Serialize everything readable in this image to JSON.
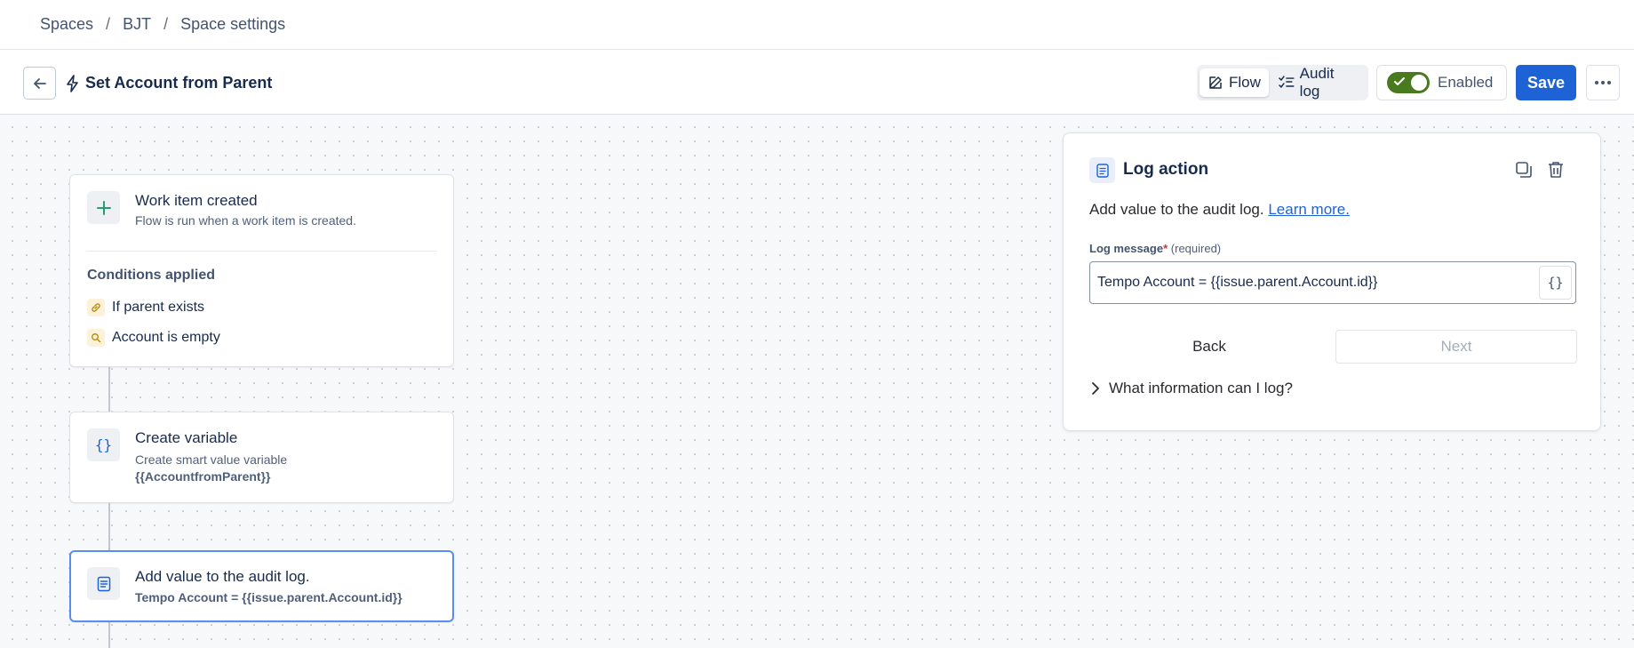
{
  "breadcrumb": {
    "items": [
      "Spaces",
      "BJT",
      "Space settings"
    ],
    "separator": "/"
  },
  "header": {
    "title": "Set Account from Parent",
    "tabs": [
      {
        "label": "Flow",
        "icon": "edit-icon",
        "active": true
      },
      {
        "label": "Audit log",
        "icon": "checklist-icon",
        "active": false
      }
    ],
    "enabled_label": "Enabled",
    "enabled": true,
    "save_label": "Save"
  },
  "flow": {
    "trigger": {
      "title": "Work item created",
      "subtitle": "Flow is run when a work item is created.",
      "conditions_heading": "Conditions applied",
      "conditions": [
        {
          "label": "If parent exists",
          "icon": "link-icon"
        },
        {
          "label": "Account is empty",
          "icon": "search-icon"
        }
      ]
    },
    "variable": {
      "title": "Create variable",
      "subtitle": "Create smart value variable",
      "value": "{{AccountfromParent}}"
    },
    "log": {
      "title": "Add value to the audit log.",
      "value": "Tempo Account = {{issue.parent.Account.id}}"
    }
  },
  "panel": {
    "title": "Log action",
    "description": "Add value to the audit log.",
    "learn_more": "Learn more.",
    "field_label": "Log message",
    "required_mark": "*",
    "required_text": "(required)",
    "field_value": "Tempo Account = {{issue.parent.Account.id}}",
    "smart_value_button": "{}",
    "back_label": "Back",
    "next_label": "Next",
    "expander_label": "What information can I log?"
  },
  "colors": {
    "primary": "#1d63d6",
    "toggle_on": "#4a7a20",
    "selected_border": "#5b8cf2"
  }
}
